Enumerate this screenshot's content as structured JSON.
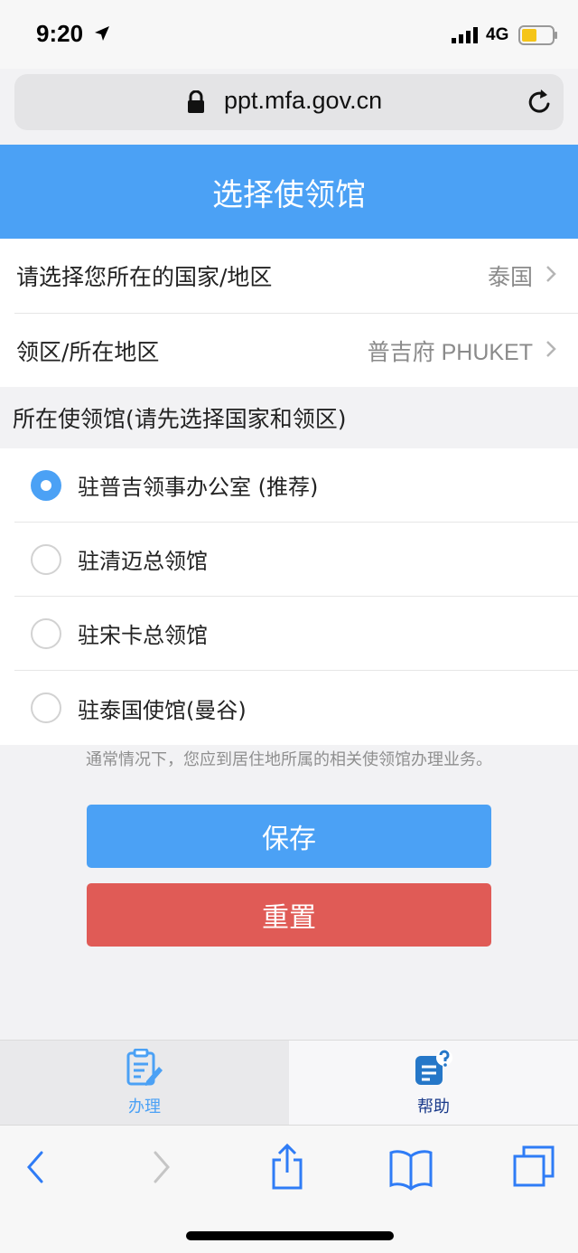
{
  "status_bar": {
    "time": "9:20",
    "network": "4G",
    "icons": [
      "location-arrow-icon",
      "signal-icon",
      "battery-icon"
    ]
  },
  "browser": {
    "url": "ppt.mfa.gov.cn",
    "icons": [
      "lock-icon",
      "reload-icon"
    ]
  },
  "header": {
    "title": "选择使领馆"
  },
  "select_rows": [
    {
      "label": "请选择您所在的国家/地区",
      "value": "泰国"
    },
    {
      "label": "领区/所在地区",
      "value": "普吉府 PHUKET"
    }
  ],
  "consulate_section": {
    "title": "所在使领馆(请先选择国家和领区)",
    "options": [
      {
        "label": "驻普吉领事办公室 (推荐)",
        "selected": true
      },
      {
        "label": "驻清迈总领馆",
        "selected": false
      },
      {
        "label": "驻宋卡总领馆",
        "selected": false
      },
      {
        "label": "驻泰国使馆(曼谷)",
        "selected": false
      }
    ]
  },
  "note": "通常情况下，您应到居住地所属的相关使领馆办理业务。",
  "actions": {
    "save_label": "保存",
    "reset_label": "重置"
  },
  "tabs": [
    {
      "label": "办理",
      "icon": "clipboard-edit-icon",
      "active": true
    },
    {
      "label": "帮助",
      "icon": "help-document-icon",
      "active": false
    }
  ],
  "toolbar": {
    "icons": [
      "back-icon",
      "forward-icon",
      "share-icon",
      "bookmarks-icon",
      "tabs-icon"
    ]
  },
  "colors": {
    "primary": "#4ba1f5",
    "danger": "#e05b56",
    "help_tab": "#1a3a8a"
  }
}
